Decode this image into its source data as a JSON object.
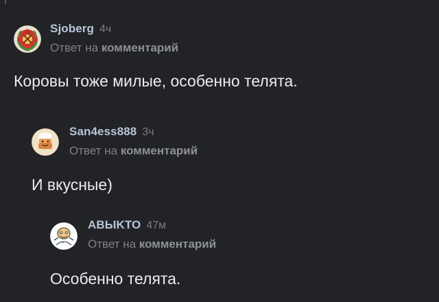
{
  "comments": [
    {
      "author": "Sjoberg",
      "time": "4ч",
      "reply_prefix": "Ответ на",
      "reply_link": "комментарий",
      "text": "Коровы тоже милые, особенно телята.",
      "avatar_icon": "soviet-emblem-icon"
    },
    {
      "author": "San4ess888",
      "time": "3ч",
      "reply_prefix": "Ответ на",
      "reply_link": "комментарий",
      "text": "И вкусные)",
      "avatar_icon": "chef-cake-icon"
    },
    {
      "author": "ABЫKTO",
      "time": "47м",
      "reply_prefix": "Ответ на",
      "reply_link": "комментарий",
      "text": "Особенно телята.",
      "avatar_icon": "cartoon-character-icon"
    }
  ]
}
